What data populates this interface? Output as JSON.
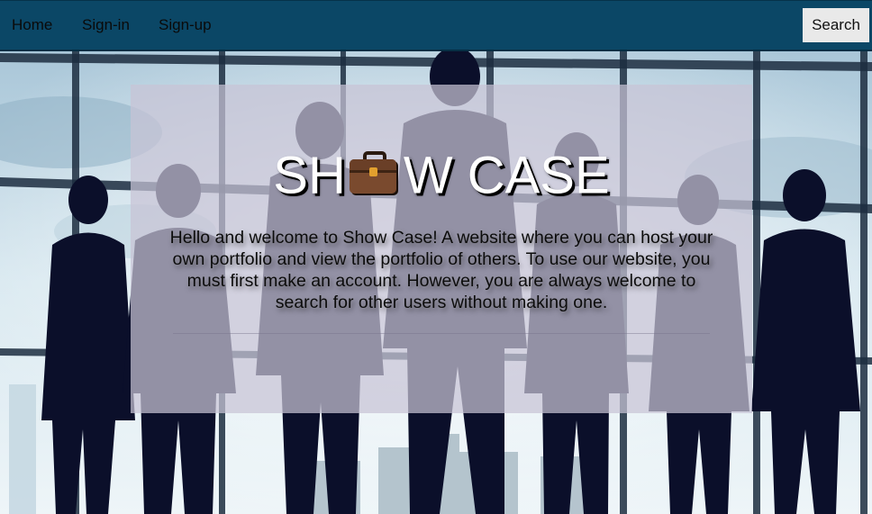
{
  "nav": {
    "links": [
      "Home",
      "Sign-in",
      "Sign-up"
    ],
    "search_label": "Search"
  },
  "hero": {
    "title_left": "SH",
    "title_icon": "briefcase-icon",
    "title_right": "W CASE",
    "intro": "Hello and welcome to Show Case! A website where you can host your own portfolio and view the portfolio of others. To use our website, you must first make an account. However, you are always welcome to search for other users without making one."
  },
  "colors": {
    "navbar": "#0b4766",
    "search_button": "#e9e9e9",
    "hero_card": "#c8c4d6"
  }
}
